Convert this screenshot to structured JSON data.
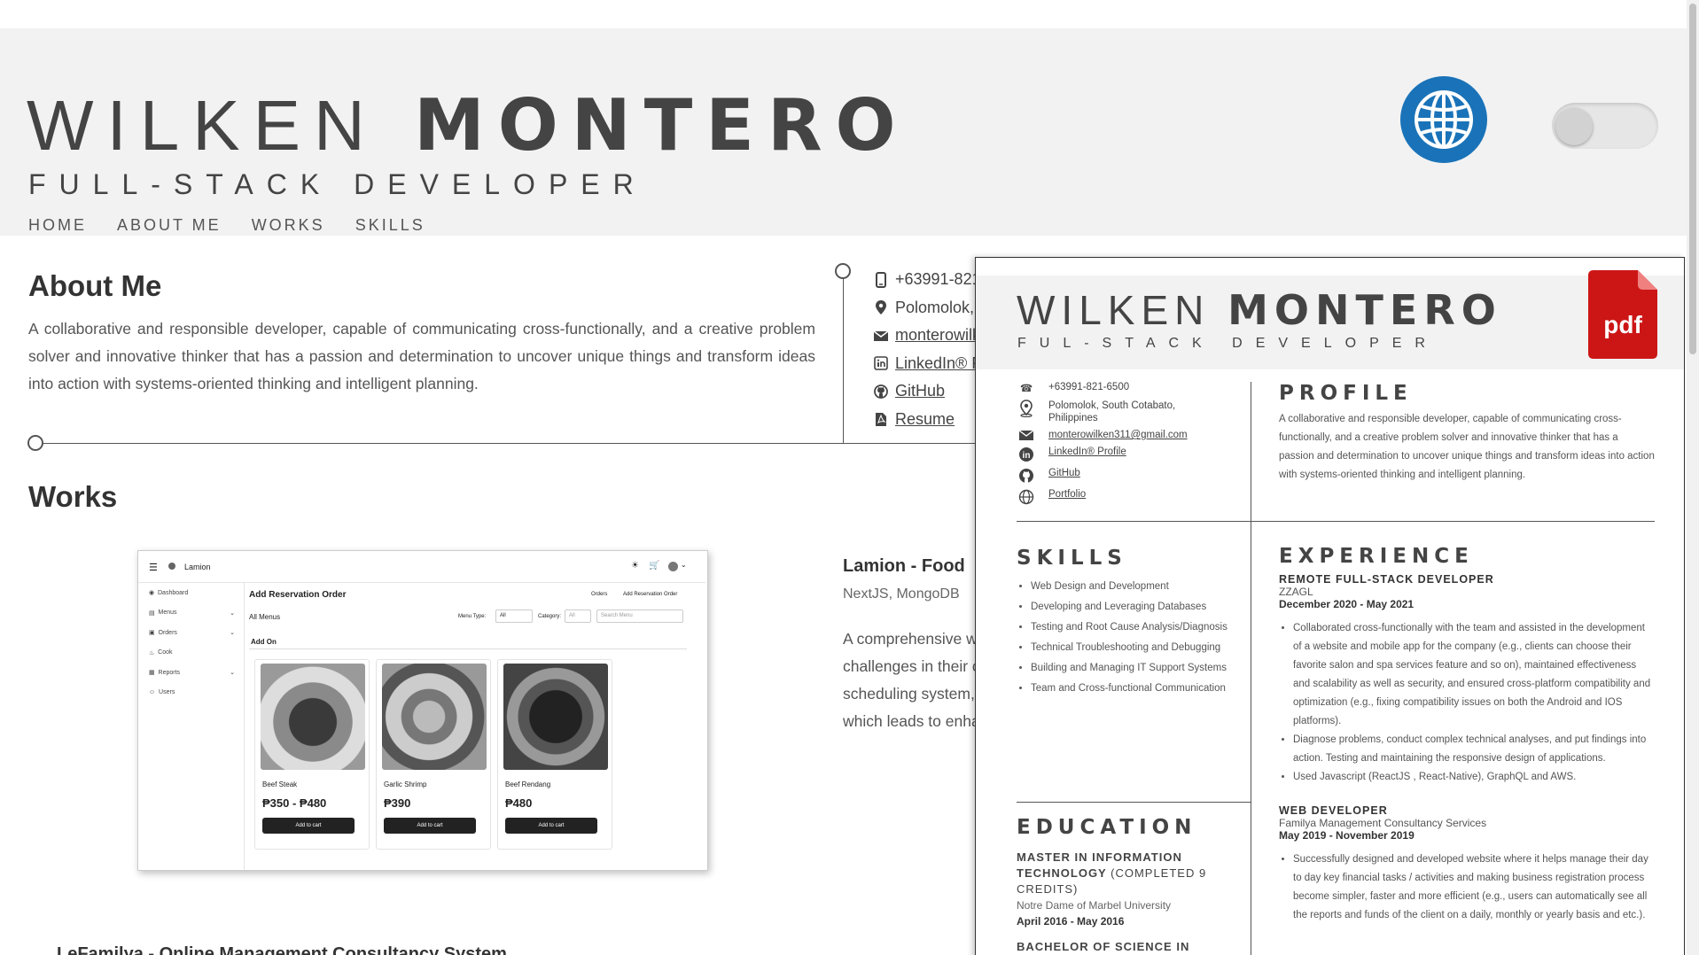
{
  "header": {
    "first_name": "WILKEN",
    "last_name": "MONTERO",
    "role": "FULL-STACK DEVELOPER",
    "nav": [
      "HOME",
      "ABOUT ME",
      "WORKS",
      "SKILLS"
    ]
  },
  "about": {
    "title": "About Me",
    "text": "A collaborative and responsible developer, capable of communicating cross-functionally, and a creative problem solver and innovative thinker that has a passion and determination to uncover unique things and transform ideas into action with systems-oriented thinking and intelligent planning."
  },
  "contacts": {
    "phone": "+63991-821",
    "location": "Polomolok, S",
    "email": "monterowilk",
    "linkedin": "LinkedIn® P",
    "github": "GitHub",
    "resume": "Resume"
  },
  "works": {
    "title": "Works",
    "project1": {
      "title": "Lamion - Food",
      "stack": "NextJS, MongoDB",
      "desc_lines": [
        "A comprehensive w",
        "challenges in their c",
        "scheduling system,",
        "which leads to enha"
      ]
    },
    "project2_title": "LeFamilya - Online Management Consultancy System",
    "screenshot": {
      "app_name": "Lamion",
      "page_title": "Add Reservation Order",
      "breadcrumb_1": "Orders",
      "breadcrumb_2": "Add Reservation Order",
      "all_menus": "All Menus",
      "menu_type_label": "Menu Type:",
      "menu_type_value": "All",
      "category_label": "Category:",
      "category_value": "All",
      "search_placeholder": "Search Menu",
      "section": "Add On",
      "sidebar": [
        "Dashboard",
        "Menus",
        "Orders",
        "Cook",
        "Reports",
        "Users"
      ],
      "items": [
        {
          "name": "Beef Steak",
          "price": "₱350 - ₱480",
          "button": "Add to cart"
        },
        {
          "name": "Garlic Shrimp",
          "price": "₱390",
          "button": "Add to cart"
        },
        {
          "name": "Beef Rendang",
          "price": "₱480",
          "button": "Add to cart"
        }
      ]
    }
  },
  "resume": {
    "first_name": "WILKEN",
    "last_name": "MONTERO",
    "role": "FUL-STACK DEVELOPER",
    "pdf_label": "pdf",
    "phone": "+63991-821-6500",
    "location": "Polomolok, South Cotabato, Philippines",
    "email": "monterowilken311@gmail.com",
    "linkedin": "LinkedIn® Profile",
    "github": "GitHub",
    "portfolio": "Portfolio",
    "profile_title": "PROFILE",
    "profile_text": "A collaborative and responsible developer, capable of communicating cross-functionally, and a creative problem solver and innovative thinker that has a passion and determination to uncover unique things and transform ideas into action with systems-oriented thinking and intelligent planning.",
    "skills_title": "SKILLS",
    "skills": [
      "Web Design and Development",
      "Developing and Leveraging Databases",
      "Testing and Root Cause Analysis/Diagnosis",
      "Technical Troubleshooting and Debugging",
      "Building and Managing IT Support Systems",
      "Team and Cross-functional Communication"
    ],
    "experience_title": "EXPERIENCE",
    "jobs": [
      {
        "title": "REMOTE FULL-STACK DEVELOPER",
        "company": "ZZAGL",
        "dates": "December 2020 - May 2021",
        "bullets": [
          "Collaborated cross-functionally with the team and assisted in the development of a website and mobile app for the company (e.g., clients can choose their favorite salon and spa services feature and so on), maintained effectiveness and scalability as well as security, and ensured cross-platform compatibility and optimization (e.g., fixing compatibility issues on both the Android and IOS platforms).",
          "Diagnose problems, conduct complex technical analyses, and put findings into action. Testing and maintaining the responsive design of applications.",
          "Used Javascript (ReactJS , React-Native), GraphQL and AWS."
        ]
      },
      {
        "title": "WEB DEVELOPER",
        "company": "Familya Management Consultancy Services",
        "dates": "May 2019 - November 2019",
        "bullets": [
          "Successfully designed and developed website where it helps manage their day to day key financial tasks / activities and making business registration process become simpler, faster and more efficient (e.g., users can automatically see all the reports and funds of the client on a daily, monthly or yearly basis and etc.)."
        ]
      }
    ],
    "education_title": "EDUCATION",
    "edu1_degree": "MASTER IN INFORMATION TECHNOLOGY",
    "edu1_note": "(COMPLETED 9 CREDITS)",
    "edu1_school": "Notre Dame of Marbel University",
    "edu1_dates": "April 2016 - May 2016",
    "edu2_degree": "BACHELOR OF SCIENCE IN"
  },
  "colors": {
    "globe": "#1a73b8",
    "pdf": "#cc1616",
    "header_bg": "#f2f2f2"
  }
}
